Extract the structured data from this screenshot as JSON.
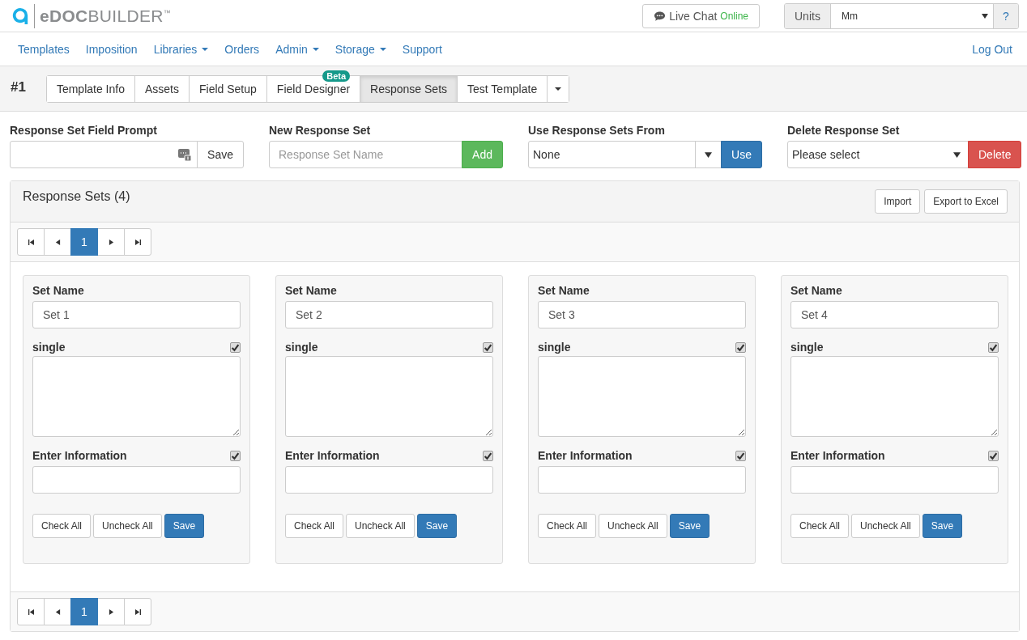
{
  "header": {
    "logo": "**eDOC**BUILDER$^{™}$",
    "live_chat": {
      "label": "Live Chat",
      "status": "Online"
    },
    "units": {
      "label": "Units",
      "value": "Mm",
      "help": "?"
    }
  },
  "nav": {
    "items": [
      {
        "label": "Templates",
        "has_menu": false
      },
      {
        "label": "Imposition",
        "has_menu": false
      },
      {
        "label": "Libraries",
        "has_menu": true
      },
      {
        "label": "Orders",
        "has_menu": false
      },
      {
        "label": "Admin",
        "has_menu": true
      },
      {
        "label": "Storage",
        "has_menu": true
      },
      {
        "label": "Support",
        "has_menu": false
      }
    ],
    "logout": "Log Out"
  },
  "template_bar": {
    "number": "#1",
    "tabs": [
      {
        "label": "Template Info",
        "selected": false
      },
      {
        "label": "Assets",
        "selected": false
      },
      {
        "label": "Field Setup",
        "selected": false
      },
      {
        "label": "Field Designer",
        "selected": false,
        "badge": "Beta"
      },
      {
        "label": "Response Sets",
        "selected": true
      },
      {
        "label": "Test Template",
        "selected": false
      }
    ]
  },
  "form": {
    "field_prompt": {
      "label": "Response Set Field Prompt",
      "button": "Save"
    },
    "new_set": {
      "label": "New Response Set",
      "placeholder": "Response Set Name",
      "button": "Add"
    },
    "use_from": {
      "label": "Use Response Sets From",
      "value": "None",
      "button": "Use"
    },
    "delete_set": {
      "label": "Delete Response Set",
      "value": "Please select",
      "button": "Delete"
    }
  },
  "panel": {
    "title": "Response Sets (4)",
    "actions": [
      "Import",
      "Export to Excel"
    ],
    "pager_top": [
      {
        "label": "1",
        "selected": true
      }
    ],
    "pager_bottom": [
      {
        "label": "1",
        "selected": true
      }
    ],
    "sets": [
      {
        "name_label": "Set Name",
        "name": "Set 1",
        "fields": [
          {
            "label": "single",
            "kind": "textarea",
            "checked": true
          },
          {
            "label": "Enter Information",
            "kind": "input",
            "checked": true
          }
        ],
        "buttons": [
          "Check All",
          "Uncheck All",
          "Save"
        ]
      },
      {
        "name_label": "Set Name",
        "name": "Set 2",
        "fields": [
          {
            "label": "single",
            "kind": "textarea",
            "checked": true
          },
          {
            "label": "Enter Information",
            "kind": "input",
            "checked": true
          }
        ],
        "buttons": [
          "Check All",
          "Uncheck All",
          "Save"
        ]
      },
      {
        "name_label": "Set Name",
        "name": "Set 3",
        "fields": [
          {
            "label": "single",
            "kind": "textarea",
            "checked": true
          },
          {
            "label": "Enter Information",
            "kind": "input",
            "checked": true
          }
        ],
        "buttons": [
          "Check All",
          "Uncheck All",
          "Save"
        ]
      },
      {
        "name_label": "Set Name",
        "name": "Set 4",
        "fields": [
          {
            "label": "single",
            "kind": "textarea",
            "checked": true
          },
          {
            "label": "Enter Information",
            "kind": "input",
            "checked": true
          }
        ],
        "buttons": [
          "Check All",
          "Uncheck All",
          "Save"
        ]
      }
    ]
  }
}
